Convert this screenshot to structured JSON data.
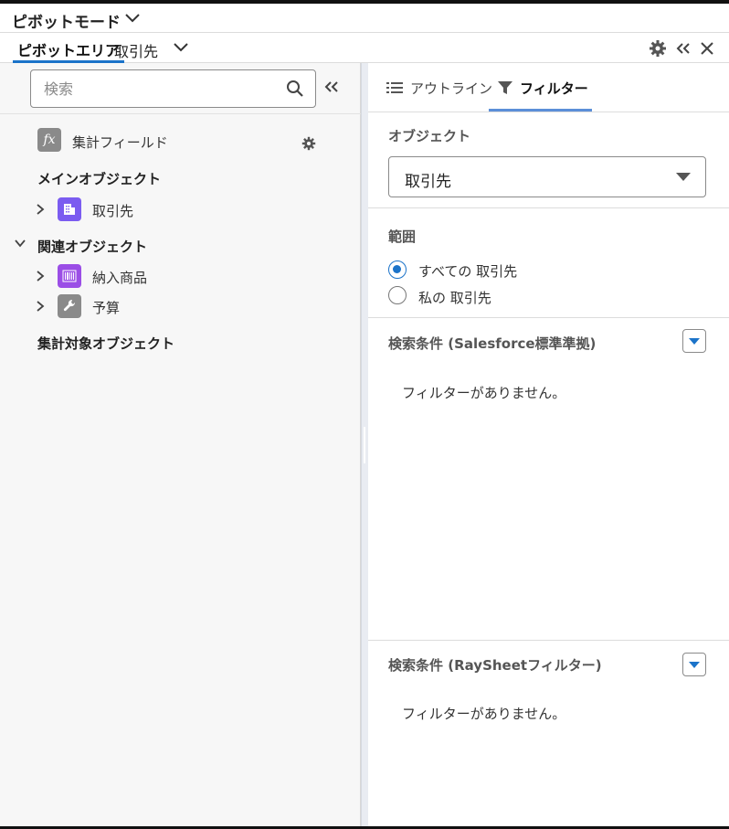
{
  "header": {
    "mode_title": "ピボットモード"
  },
  "subbar": {
    "tab_label": "ピボットエリア",
    "object_name": "取引先"
  },
  "left": {
    "search": {
      "placeholder": "検索",
      "value": ""
    },
    "calc_field_label": "集計フィールド",
    "main_object_header": "メインオブジェクト",
    "main_object": {
      "label": "取引先",
      "icon": "building-icon",
      "color": "#7b5cf0"
    },
    "related_header": "関連オブジェクト",
    "related": [
      {
        "label": "納入商品",
        "icon": "barcode-icon",
        "color": "#9b4ee6"
      },
      {
        "label": "予算",
        "icon": "wrench-icon",
        "color": "#8a8a8a"
      }
    ],
    "aggregate_header": "集計対象オブジェクト"
  },
  "right": {
    "tabs": {
      "outline": "アウトライン",
      "filter": "フィルター"
    },
    "object_label": "オブジェクト",
    "object_value": "取引先",
    "scope_label": "範囲",
    "scope_options": [
      {
        "label": "すべての 取引先",
        "selected": true
      },
      {
        "label": "私の 取引先",
        "selected": false
      }
    ],
    "cond1_label": "検索条件 (Salesforce標準準拠)",
    "cond1_empty": "フィルターがありません。",
    "cond2_label": "検索条件 (RaySheetフィルター)",
    "cond2_empty": "フィルターがありません。"
  },
  "colors": {
    "accent": "#1b73c9",
    "tab_underline": "#5b8fd8"
  }
}
